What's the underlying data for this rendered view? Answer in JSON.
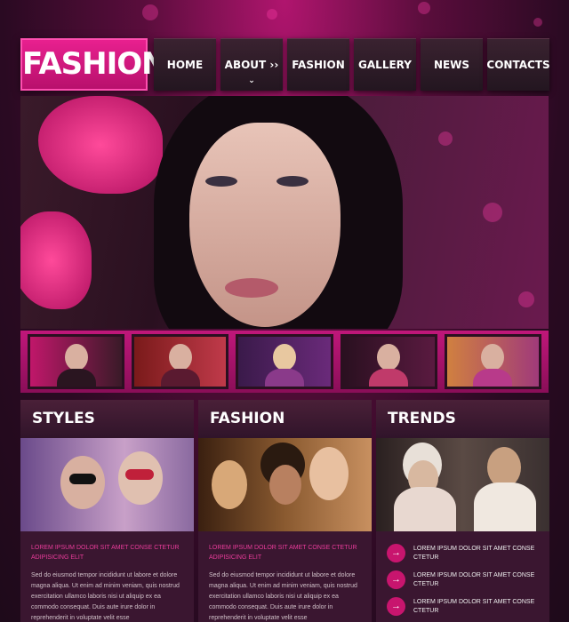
{
  "logo": "FASHION",
  "nav": [
    {
      "label": "HOME"
    },
    {
      "label": "ABOUT ››",
      "chevron": "⌄"
    },
    {
      "label": "FASHION"
    },
    {
      "label": "GALLERY"
    },
    {
      "label": "NEWS"
    },
    {
      "label": "CONTACTS"
    }
  ],
  "columns": {
    "styles": {
      "title": "STYLES",
      "subtitle": "LOREM IPSUM DOLOR SIT AMET CONSE CTETUR ADIPISICING ELIT",
      "body": "Sed do eiusmod tempor incididunt ut labore et dolore magna aliqua. Ut enim ad minim veniam, quis nostrud exercitation ullamco laboris nisi ut aliquip ex ea commodo consequat. Duis aute irure dolor in reprehenderit in voluptate velit esse"
    },
    "fashion": {
      "title": "FASHION",
      "subtitle": "LOREM IPSUM DOLOR SIT AMET CONSE CTETUR ADIPISICING ELIT",
      "body": "Sed do eiusmod tempor incididunt ut labore et dolore magna aliqua. Ut enim ad minim veniam, quis nostrud exercitation ullamco laboris nisi ut aliquip ex ea commodo consequat. Duis aute irure dolor in reprehenderit in voluptate velit esse"
    },
    "trends": {
      "title": "TRENDS",
      "items": [
        "LOREM IPSUM DOLOR SIT AMET CONSE CTETUR",
        "LOREM IPSUM DOLOR SIT AMET CONSE CTETUR",
        "LOREM IPSUM DOLOR SIT AMET CONSE CTETUR"
      ]
    }
  },
  "icons": {
    "trend_arrow": "arrow-right-icon"
  },
  "colors": {
    "accent": "#e01c86",
    "dark": "#231620"
  }
}
